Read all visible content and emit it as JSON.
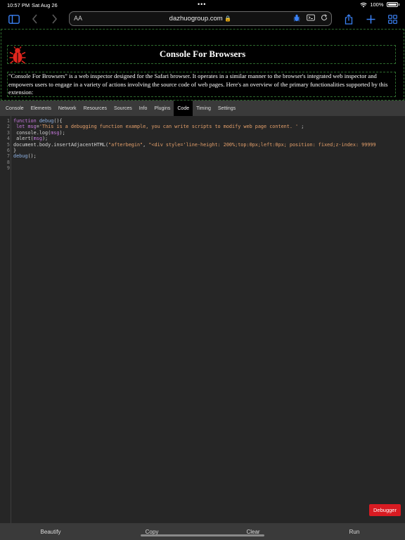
{
  "status_bar": {
    "time": "10:57 PM",
    "date": "Sat Aug 26",
    "battery": "100%",
    "dots": "•••"
  },
  "toolbar": {
    "text_size_label": "AA",
    "domain": "dazhuogroup.com"
  },
  "page": {
    "title": "Console For Browsers",
    "description": "\"Console For Browsers\" is a web inspector designed for the Safari browser. It operates in a similar manner to the browser's integrated web inspector and empowers users to engage in a variety of actions involving the source code of web pages. Here's an overview of the primary functionalities supported by this extension:"
  },
  "devtools": {
    "tabs": [
      "Console",
      "Elements",
      "Network",
      "Resources",
      "Sources",
      "Info",
      "Plugins",
      "Code",
      "Timing",
      "Settings"
    ],
    "active_tab": "Code",
    "line_numbers": [
      "1",
      "2",
      "3",
      "4",
      "5",
      "6",
      "7",
      "8",
      "9"
    ],
    "code_lines": [
      "function debug(){",
      " let msg='This is a debugging function example, you can write scripts to modify web page content. ' ;",
      " console.log(msg);",
      " alert(msg);",
      "document.body.insertAdjacentHTML(\"afterbegin\", \"<div style='line-height: 200%;top:0px;left:0px; position: fixed;z-index: 99999",
      "}",
      "debug();",
      "",
      ""
    ],
    "debugger_label": "Debugger"
  },
  "bottom_bar": {
    "beautify": "Beautify",
    "copy": "Copy",
    "clear": "Clear",
    "run": "Run"
  },
  "colors": {
    "accent": "#3b82f6",
    "debugger_red": "#d81b22",
    "logo_red": "#e0261d",
    "panel_bg": "#262626",
    "tab_bar_bg": "#3a3a3a"
  }
}
